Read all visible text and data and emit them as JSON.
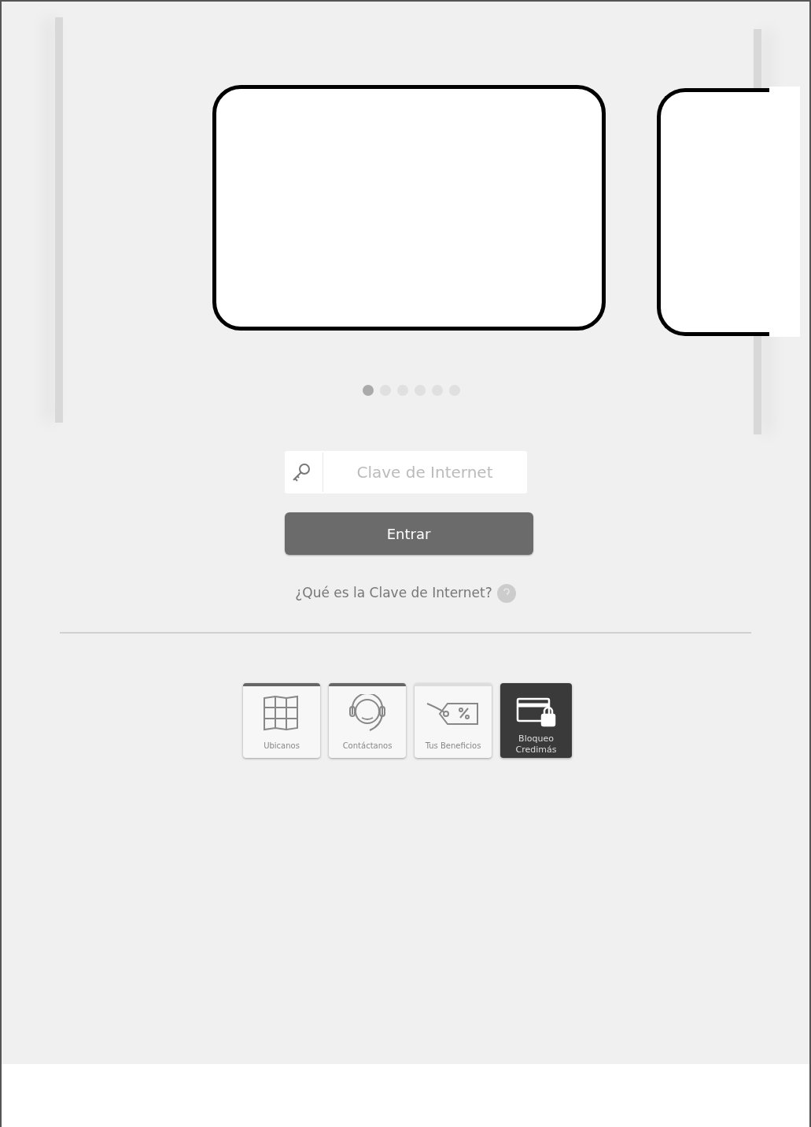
{
  "carousel": {
    "dots": [
      {
        "selected": true
      },
      {
        "selected": false
      },
      {
        "selected": false
      },
      {
        "selected": false
      },
      {
        "selected": false
      },
      {
        "selected": false
      }
    ]
  },
  "login": {
    "placeholder": "Clave de Internet",
    "button": "Entrar",
    "help_link": "¿Qué es la Clave de Internet?"
  },
  "shortcuts": [
    {
      "label": "Ubicanos",
      "kind": "bar"
    },
    {
      "label": "Contáctanos",
      "kind": "bar"
    },
    {
      "label": "Tus Beneficios",
      "kind": "plain"
    },
    {
      "label": "Bloqueo Credimás",
      "kind": "dark"
    }
  ]
}
